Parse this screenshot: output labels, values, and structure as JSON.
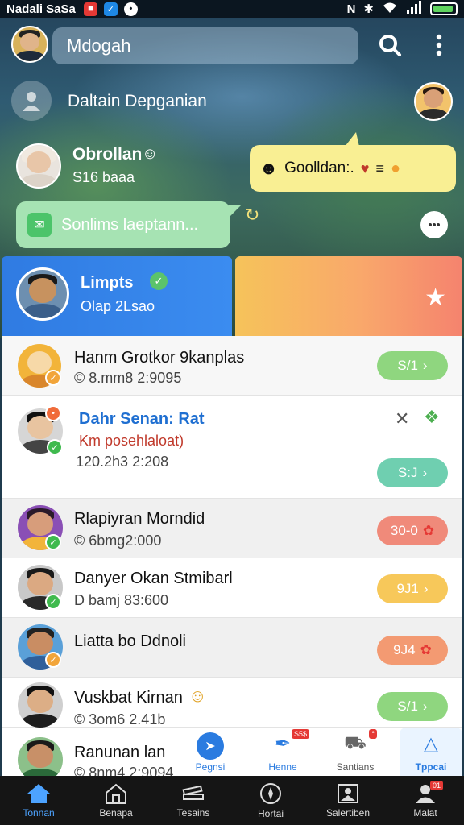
{
  "status_bar": {
    "carrier": "Nadali SaSa",
    "apps": [
      {
        "icon": "red-app-icon",
        "color": "#e53935"
      },
      {
        "icon": "blue-app-icon",
        "color": "#1e88e5"
      },
      {
        "icon": "message-app-icon",
        "color": "#ffffff"
      }
    ]
  },
  "top_bar": {
    "search_text": "Mdogah"
  },
  "add_contact": {
    "label": "Daltain Depganian"
  },
  "chat_preview": {
    "name": "Obrollan",
    "subtitle": "S16 baaa"
  },
  "bubble_yellow": {
    "text": "Goolldan:."
  },
  "bubble_green": {
    "text": "Sonlims laeptann..."
  },
  "featured": {
    "name": "Limpts",
    "subtitle": "Olap 2Lsao"
  },
  "contacts": [
    {
      "name": "Hanm Grotkor 9kanplas",
      "sub": "© 8.mm8 2:9095",
      "pill": "S/1",
      "pill_color": "#8fd67f",
      "name_color": "#c0392b"
    },
    {
      "name": "Dahr Senan: Rat",
      "sub2": "Km posehlaloat)",
      "sub": "120.2h3 2:208",
      "pill": "S:J",
      "pill_color": "#6fcfb0",
      "name_color": "#1f6fd1"
    },
    {
      "name": "Rlapiyran Morndid",
      "sub": "© 6bmg2:000",
      "pill": "30-0",
      "pill_color": "#f08a7a",
      "name_color": "#111111"
    },
    {
      "name": "Danyer Okan Stmibarl",
      "sub": "D bamj 83:600",
      "pill": "9J1",
      "pill_color": "#f7c85a",
      "name_color": "#111111"
    },
    {
      "name": "Liatta bo Ddnoli",
      "sub": "",
      "pill": "9J4",
      "pill_color": "#f39a72",
      "name_color": "#111111"
    },
    {
      "name": "Vuskbat Kirnan",
      "sub": "© 3om6 2.41b",
      "pill": "S/1",
      "pill_color": "#8fd67f",
      "name_color": "#111111"
    },
    {
      "name": "Ranunan lan",
      "sub": "© 8nm4 2:9094",
      "pill": "",
      "pill_color": "#f7d7c5",
      "name_color": "#111111"
    }
  ],
  "fab_strip": [
    {
      "label": "Pegnsi",
      "icon": "send-icon"
    },
    {
      "label": "Henne",
      "icon": "pen-icon",
      "badge": "S5$"
    },
    {
      "label": "Santians",
      "icon": "car-icon",
      "badge": "°"
    },
    {
      "label": "Tppcai",
      "icon": "bell-icon"
    }
  ],
  "bottom_nav": [
    {
      "label": "Tonnan",
      "icon": "home-icon",
      "active": true
    },
    {
      "label": "Benapa",
      "icon": "store-icon"
    },
    {
      "label": "Tesains",
      "icon": "books-icon"
    },
    {
      "label": "Hortai",
      "icon": "compass-icon"
    },
    {
      "label": "Salertiben",
      "icon": "gallery-icon"
    },
    {
      "label": "Malat",
      "icon": "profile-icon",
      "badge": "01"
    }
  ],
  "colors": {
    "accent_blue": "#2f7be2",
    "status_bg": "#0b1620",
    "nav_bg": "#151515"
  }
}
